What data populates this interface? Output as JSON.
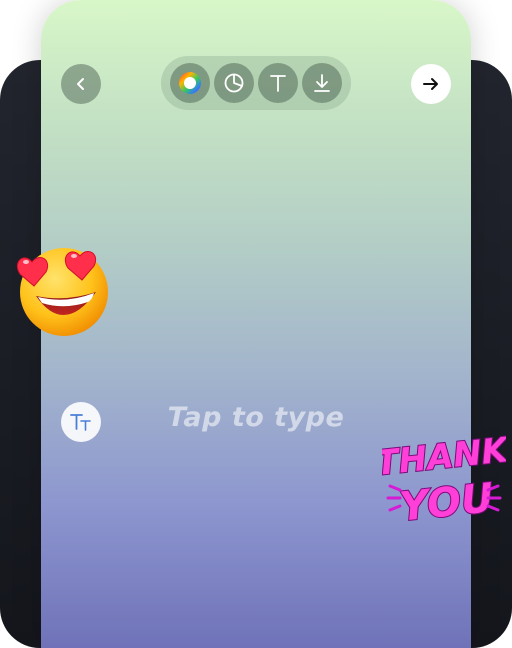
{
  "toolbar": {
    "tools": [
      {
        "icon": "color-wheel-icon"
      },
      {
        "icon": "sticker-icon"
      },
      {
        "icon": "text-icon"
      },
      {
        "icon": "download-icon"
      }
    ]
  },
  "navigation": {
    "back_icon": "chevron-left-icon",
    "next_icon": "arrow-right-icon"
  },
  "editor": {
    "placeholder": "Tap to type",
    "text_style_icon": "text-size-icon"
  },
  "stickers": {
    "emoji": "heart-eyes-emoji",
    "thank_you_line1": "THANK",
    "thank_you_line2": "YOU"
  },
  "colors": {
    "accent_text_blue": "#4a7fd6",
    "sticker_magenta": "#d61ad6",
    "sticker_pink": "#ff3fd8",
    "gradient_top": "#d8f7c8",
    "gradient_bottom": "#6f72b8"
  }
}
